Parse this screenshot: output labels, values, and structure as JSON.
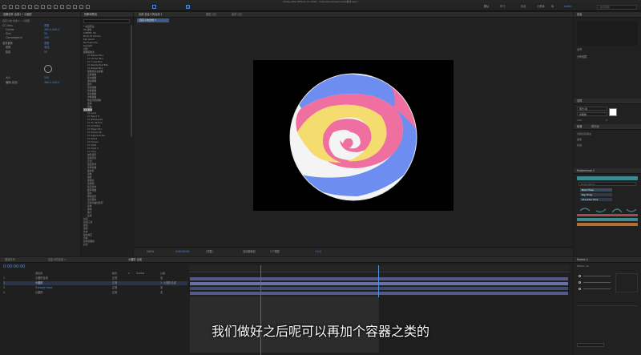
{
  "window_title": "Adobe After Effects CC 2018 - /Users/pro/Downloads/素材.aep *",
  "menu": {
    "workspaces": [
      "默认",
      "学习",
      "标准",
      "小屏幕",
      "库",
      "audio"
    ],
    "search_placeholder": "搜索帮助"
  },
  "project": {
    "tab": "效果控件 合成",
    "title": "效果控件 合成1 • 小圆形",
    "layer_path": "自定义的 合成 1 • 小圆形",
    "rows": [
      {
        "name": "CC Lens",
        "value": "重置"
      },
      {
        "name": "Center",
        "value": "360.0,540.0"
      },
      {
        "name": "Size",
        "value": "50"
      },
      {
        "name": "Convergence",
        "value": "100"
      },
      {
        "name": "湍流置换",
        "value": "重置"
      },
      {
        "name": "置换",
        "value": "湍流"
      },
      {
        "name": "数量",
        "value": "50"
      },
      {
        "name": "大小",
        "value": "100"
      },
      {
        "name": "偏移(湍流)",
        "value": "360.0,540.0"
      }
    ]
  },
  "effects_list": {
    "tab": "效果和预设",
    "search_placeholder": "",
    "items": [
      "* 动画预设",
      "3D 通道",
      "CINEMA 4D",
      "Boris FX Mocha",
      "Red Giant",
      "RG Trapcode",
      "Keylight",
      "过渡",
      "模糊和锐化",
      "CC Radial Blur",
      "CC Vector Blur",
      "CC Cross Blur",
      "CC Radial Fast Blur",
      "CC Bokeh Blur",
      "摄像机镜头模糊",
      "高斯模糊",
      "径向模糊",
      "通道模糊",
      "锐化",
      "双向模糊",
      "智能模糊",
      "复合模糊",
      "方框模糊",
      "快速方框模糊",
      "变换",
      "扭曲",
      "湍流置换",
      "CC Lens",
      "CC Bend It",
      "CC Blobbylize",
      "CC Flo Motion",
      "CC Griddler",
      "CC Page Turn",
      "CC Power Pin",
      "CC Ripple Pulse",
      "CC Slant",
      "CC Smear",
      "CC Split",
      "CC Split 2",
      "CC Tiler",
      "波形变形",
      "边角定位",
      "凸出",
      "改变形状",
      "光学补偿",
      "极坐标",
      "镜像",
      "偏移",
      "球面化",
      "置换图",
      "漩涡条纹",
      "旋转扭曲",
      "液化",
      "网格变形",
      "湍流置换",
      "贝塞尔曲线变形",
      "变换",
      "波纹",
      "放大",
      "生成",
      "时间",
      "实用工具",
      "通道",
      "透视",
      "文本",
      "颜色校正",
      "音频",
      "杂色和颗粒",
      "遮罩"
    ],
    "selected_index": 26
  },
  "viewer": {
    "tabs": [
      "合成 自定义的合成 1",
      "图层 (无)",
      "素材 (无)"
    ],
    "subtab": "自定义的合成 1",
    "zoom": "200%",
    "timecode": "0:00:00:00",
    "resolution": "(完整)",
    "camera": "活动摄像机",
    "views": "1个视图",
    "offset": "+0.0"
  },
  "right_panel": {
    "info_title": "信息",
    "rows": [
      "对齐",
      "分布图层",
      "字符",
      "段落",
      "跟踪器",
      "内容识别填充",
      "画笔",
      "绘画"
    ],
    "font": "苹方-简",
    "font_style": "中黑体",
    "size": "150",
    "tracking": "0",
    "plugin_title": "Rubberhose 2",
    "plugin_search": "Hose Name...",
    "plugin_buttons": [
      "New Hose",
      "Rig Hose",
      "Shoulder Pins"
    ]
  },
  "timeline": {
    "tabs": [
      "渲染队列",
      "自定义的合成 1",
      "小圆形 合成"
    ],
    "timecode": "0:00:00:00",
    "columns": [
      "源名称",
      "模式",
      "T",
      "TrkMat",
      "父级"
    ],
    "layers": [
      {
        "num": "1",
        "name": "小圆形合成",
        "mode": "正常",
        "parent": "无"
      },
      {
        "num": "2",
        "name": "小圆形",
        "mode": "正常",
        "parent": "1. 小圆形合成"
      },
      {
        "num": "3",
        "name": "Triangle Hose",
        "mode": "正常",
        "parent": "无"
      },
      {
        "num": "4",
        "name": "小圆形",
        "mode": "正常",
        "parent": "无"
      }
    ],
    "motion_title": "Motion 2",
    "motion_version": "Motion v2"
  },
  "subtitle": "我们做好之后呢可以再加个容器之类的",
  "colors": {
    "accent": "#4f8fd9",
    "pink": "#ef6fa0",
    "yellow": "#f5dc6e",
    "blue": "#6d8ef0",
    "violet_bar": "#6b6fa8",
    "plugin_teal": "#3c8a92",
    "plugin_red": "#a84a4a",
    "plugin_orange": "#b86d2e"
  }
}
